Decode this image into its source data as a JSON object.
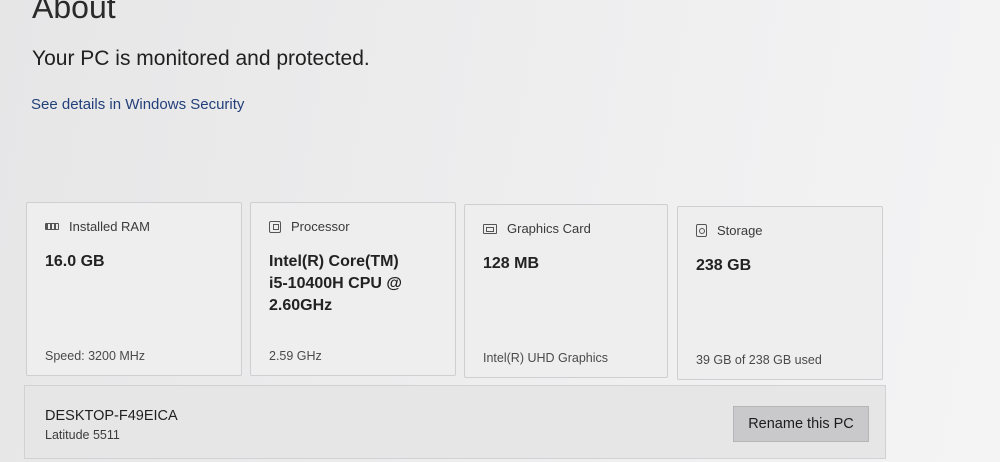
{
  "header": {
    "title": "About",
    "protection_status": "Your PC is monitored and protected.",
    "security_link": "See details in Windows Security"
  },
  "specs": [
    {
      "icon": "ram-icon",
      "label": "Installed RAM",
      "value": "16.0 GB",
      "detail": "Speed: 3200 MHz"
    },
    {
      "icon": "processor-icon",
      "label": "Processor",
      "value": "Intel(R) Core(TM)\ni5-10400H CPU @\n2.60GHz",
      "detail": "2.59 GHz"
    },
    {
      "icon": "graphics-card-icon",
      "label": "Graphics Card",
      "value": "128 MB",
      "detail": "Intel(R) UHD Graphics"
    },
    {
      "icon": "storage-icon",
      "label": "Storage",
      "value": "238 GB",
      "detail": "39 GB of 238 GB used"
    }
  ],
  "device": {
    "name": "DESKTOP-F49EICA",
    "model": "Latitude 5511",
    "rename_label": "Rename this PC"
  }
}
